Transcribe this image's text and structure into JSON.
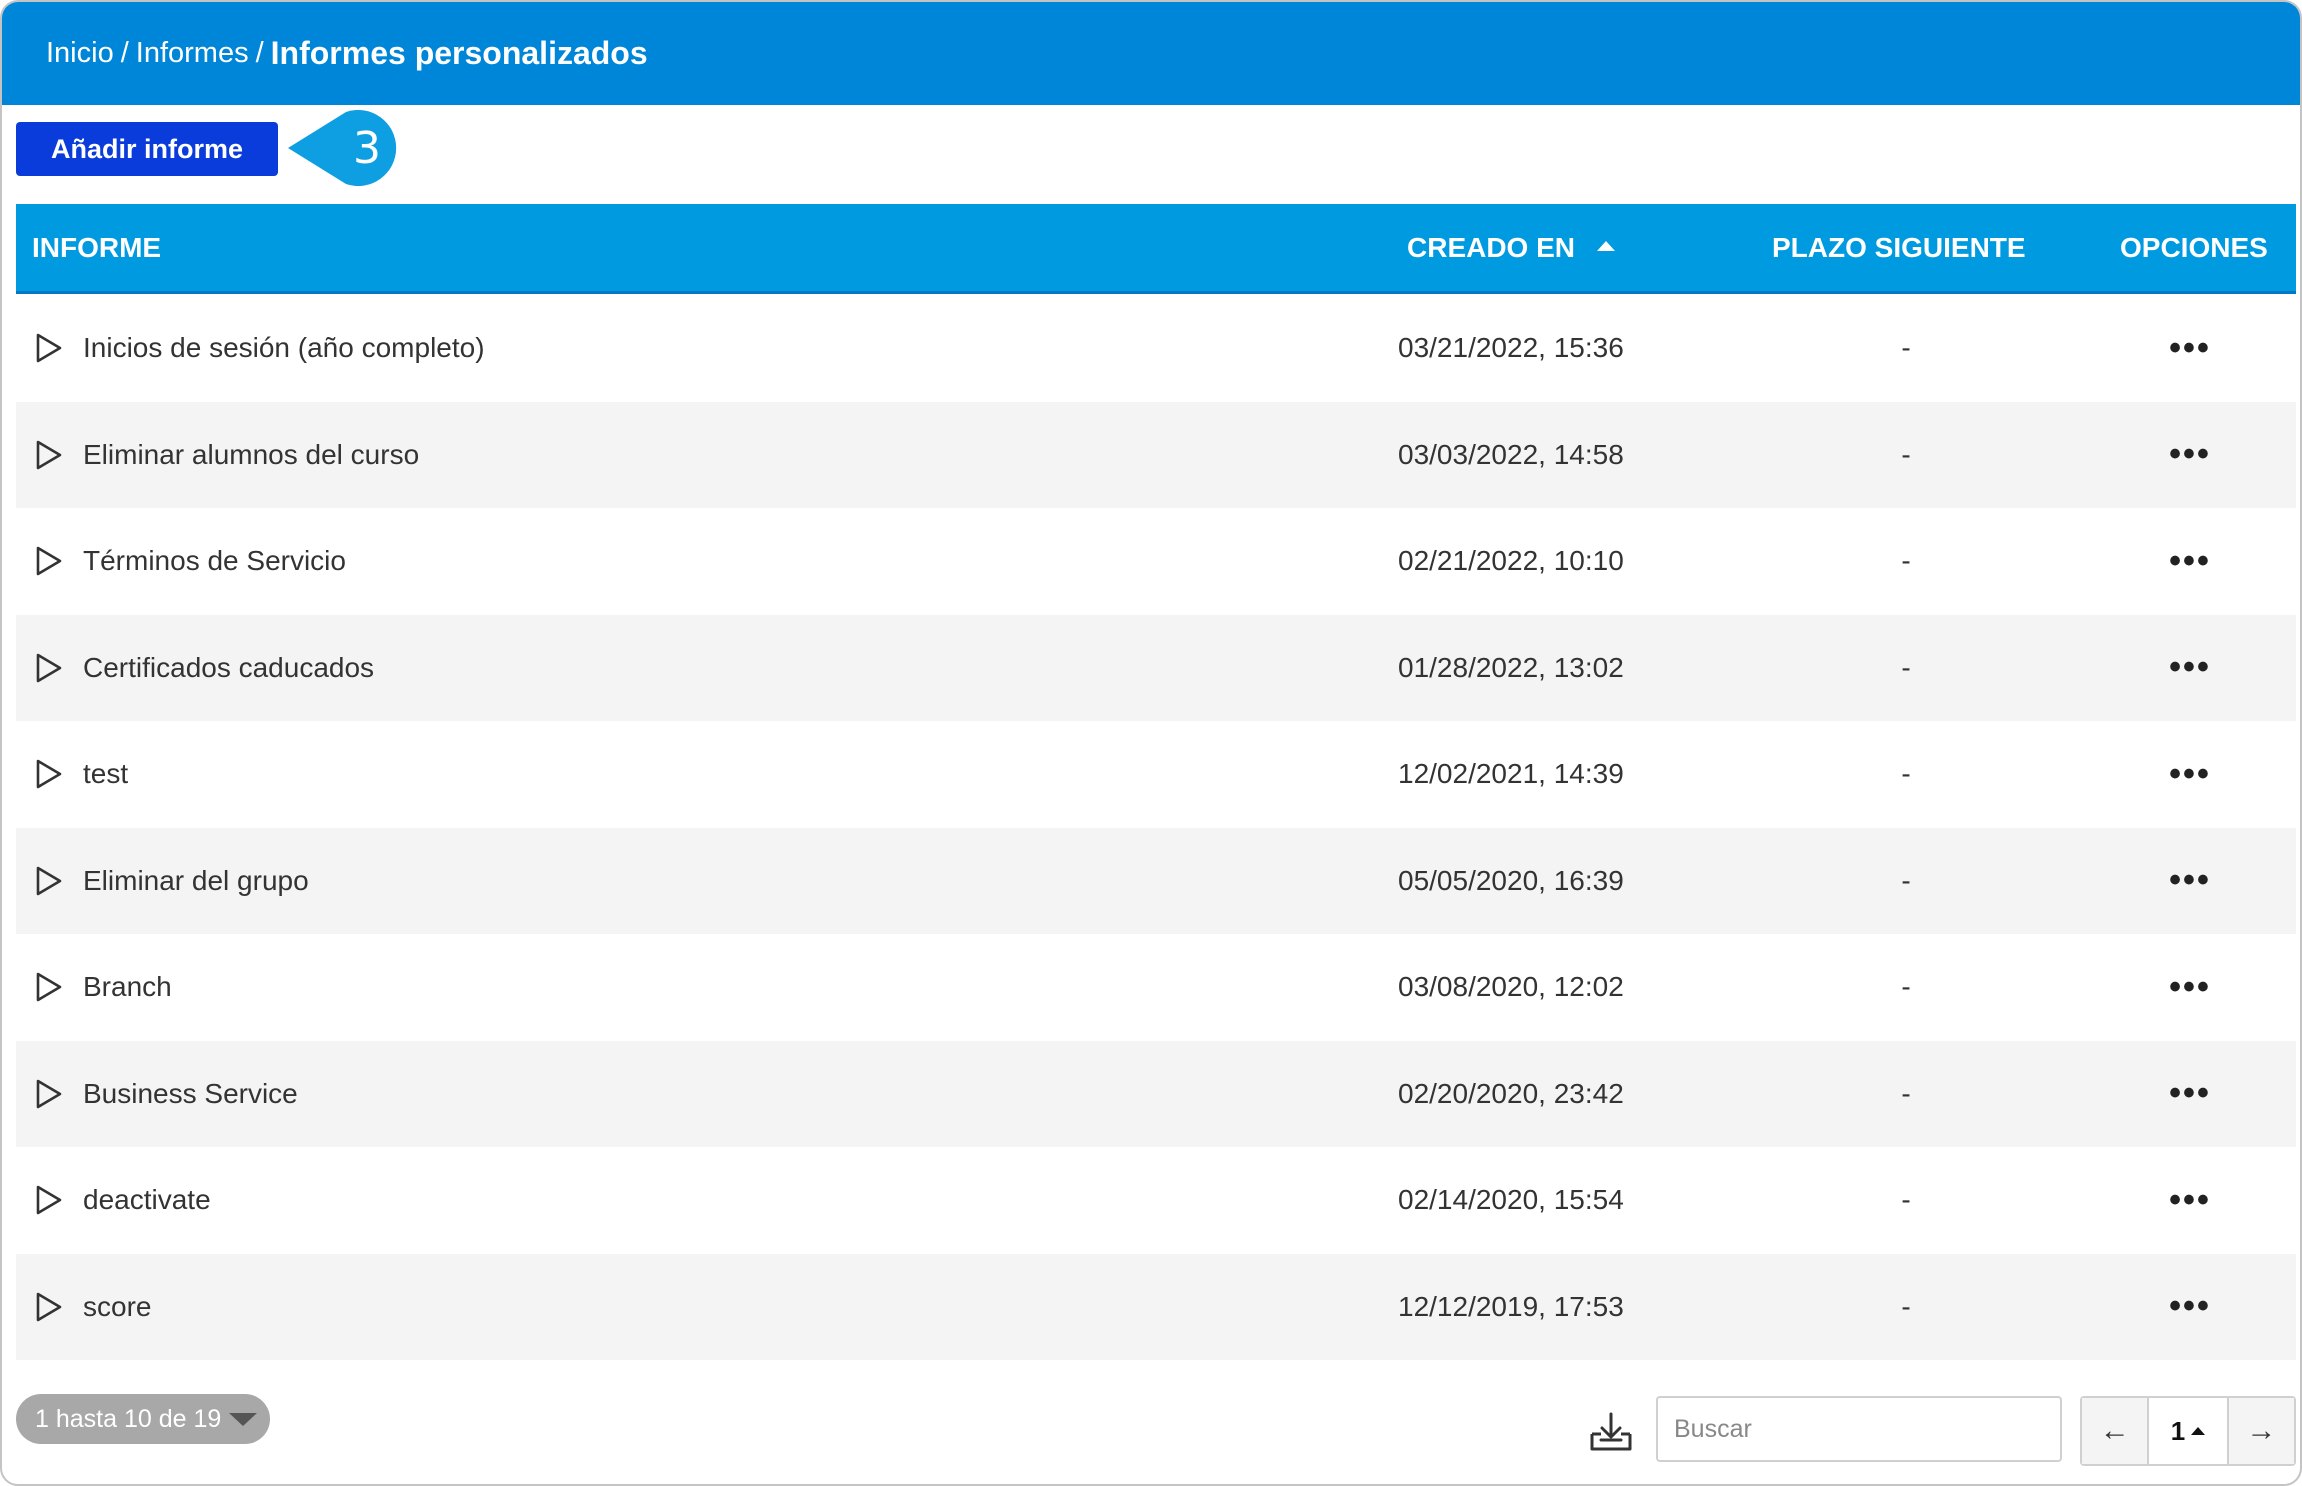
{
  "breadcrumb": {
    "items": [
      "Inicio",
      "Informes"
    ],
    "separator": "/",
    "current": "Informes personalizados"
  },
  "toolbar": {
    "add_label": "Añadir informe",
    "callout_number": "3"
  },
  "table": {
    "headers": {
      "informe": "INFORME",
      "creado_en": "CREADO EN",
      "plazo_siguiente": "PLAZO SIGUIENTE",
      "opciones": "OPCIONES"
    },
    "sort": {
      "column": "creado_en",
      "direction": "ascending-indicator"
    },
    "rows": [
      {
        "name": "Inicios de sesión (año completo)",
        "created": "03/21/2022, 15:36",
        "next": "-",
        "options": "•••"
      },
      {
        "name": "Eliminar alumnos del curso",
        "created": "03/03/2022, 14:58",
        "next": "-",
        "options": "•••"
      },
      {
        "name": "Términos de Servicio",
        "created": "02/21/2022, 10:10",
        "next": "-",
        "options": "•••"
      },
      {
        "name": "Certificados caducados",
        "created": "01/28/2022, 13:02",
        "next": "-",
        "options": "•••"
      },
      {
        "name": "test",
        "created": "12/02/2021, 14:39",
        "next": "-",
        "options": "•••"
      },
      {
        "name": "Eliminar del grupo",
        "created": "05/05/2020, 16:39",
        "next": "-",
        "options": "•••"
      },
      {
        "name": "Branch",
        "created": "03/08/2020, 12:02",
        "next": "-",
        "options": "•••"
      },
      {
        "name": "Business Service",
        "created": "02/20/2020, 23:42",
        "next": "-",
        "options": "•••"
      },
      {
        "name": "deactivate",
        "created": "02/14/2020, 15:54",
        "next": "-",
        "options": "•••"
      },
      {
        "name": "score",
        "created": "12/12/2019, 17:53",
        "next": "-",
        "options": "•••"
      }
    ]
  },
  "footer": {
    "count_label": "1 hasta 10 de 19",
    "search_placeholder": "Buscar",
    "prev_icon": "←",
    "page": "1",
    "next_icon": "→"
  },
  "colors": {
    "topbar": "#0086d8",
    "table_header": "#009ae0",
    "add_button": "#0a3cdc",
    "callout": "#0e9ee2",
    "row_alt": "#f4f4f4"
  },
  "icons": {
    "row_expand": "play-outline-icon",
    "row_options": "more-horizontal-icon",
    "sort": "sort-up-icon",
    "export": "download-tray-icon",
    "count_dropdown": "caret-down-icon"
  }
}
